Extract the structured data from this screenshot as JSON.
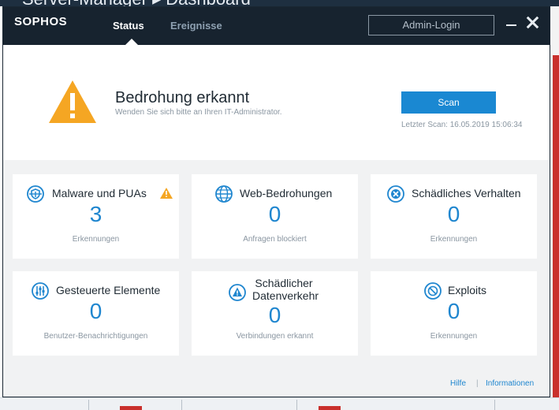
{
  "background": {
    "window_title": "Server-Manager ▸ Dashboard"
  },
  "app": {
    "logo": "SOPHOS"
  },
  "tabs": [
    {
      "label": "Status",
      "active": true
    },
    {
      "label": "Ereignisse",
      "active": false
    }
  ],
  "header": {
    "admin_login_label": "Admin-Login"
  },
  "alert": {
    "title": "Bedrohung erkannt",
    "subtitle": "Wenden Sie sich bitte an Ihren IT-Administrator.",
    "scan_label": "Scan",
    "last_scan": "Letzter Scan: 16.05.2019 15:06:34",
    "icon": "warning-icon"
  },
  "cards": [
    {
      "title": "Malware und PUAs",
      "value": "3",
      "label": "Erkennungen",
      "icon": "shield-bug-icon",
      "warning": true
    },
    {
      "title": "Web-Bedrohungen",
      "value": "0",
      "label": "Anfragen blockiert",
      "icon": "globe-icon",
      "warning": false
    },
    {
      "title": "Schädliches Verhalten",
      "value": "0",
      "label": "Erkennungen",
      "icon": "blocked-behavior-icon",
      "warning": false
    },
    {
      "title": "Gesteuerte Elemente",
      "value": "0",
      "label": "Benutzer-Benachrichtigungen",
      "icon": "sliders-icon",
      "warning": false
    },
    {
      "title": "Schädlicher Datenverkehr",
      "value": "0",
      "label": "Verbindungen erkannt",
      "icon": "traffic-warning-icon",
      "warning": false
    },
    {
      "title": "Exploits",
      "value": "0",
      "label": "Erkennungen",
      "icon": "no-entry-icon",
      "warning": false
    }
  ],
  "footer": {
    "help_label": "Hilfe",
    "separator": "|",
    "info_label": "Informationen"
  },
  "colors": {
    "accent": "#1a88d2",
    "warning": "#f5a623",
    "titlebar": "#17232f"
  }
}
